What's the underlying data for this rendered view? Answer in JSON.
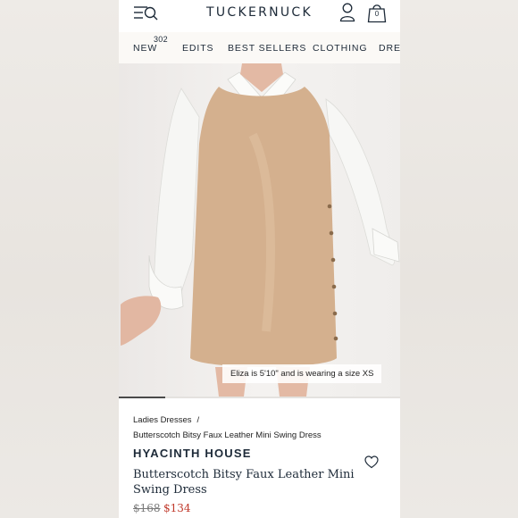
{
  "header": {
    "brand": "TUCKERNUCK",
    "bag_count": "0",
    "icons": [
      "menu-search-icon",
      "user-icon",
      "bag-icon"
    ]
  },
  "nav": {
    "items": [
      {
        "label": "NEW",
        "badge": "302"
      },
      {
        "label": "EDITS"
      },
      {
        "label": "BEST SELLERS"
      },
      {
        "label": "CLOTHING"
      },
      {
        "label": "DRES"
      }
    ]
  },
  "hero": {
    "caption": "Eliza is 5'10\" and is wearing a size XS",
    "carousel": {
      "active_index": 1,
      "total_slides": 6
    }
  },
  "breadcrumb": {
    "parent": "Ladies Dresses",
    "separator": "/",
    "current": "Butterscotch Bitsy Faux Leather Mini Swing Dress"
  },
  "product": {
    "brand": "HYACINTH HOUSE",
    "name": "Butterscotch Bitsy Faux Leather Mini Swing Dress",
    "price_original": "$168",
    "price_sale": "$134",
    "sale_color": "#c0392b"
  }
}
